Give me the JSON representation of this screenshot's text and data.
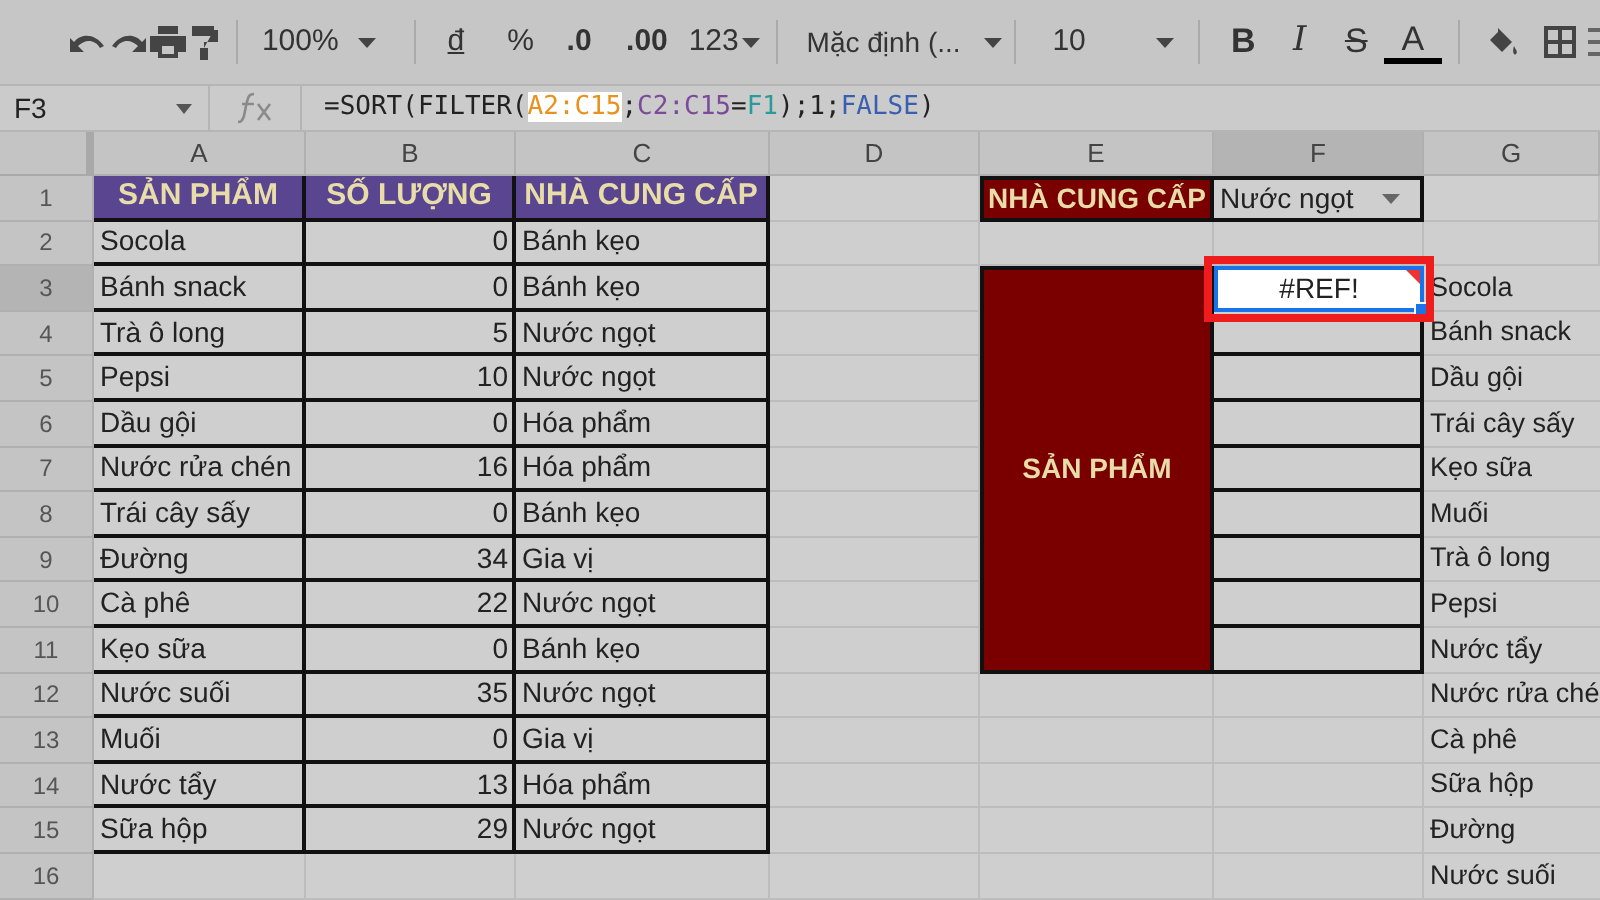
{
  "toolbar": {
    "zoom": "100%",
    "currency": "đ",
    "percent": "%",
    "decrease_decimals": ".0",
    "increase_decimals": ".00",
    "number_format": "123",
    "font": "Mặc định (...",
    "font_size": "10",
    "bold": "B",
    "italic": "I",
    "strikethrough": "S",
    "text_color": "A"
  },
  "formula_bar": {
    "cell_ref": "F3",
    "formula": [
      {
        "text": "=SORT(FILTER(",
        "kind": "plain"
      },
      {
        "text": "A2:C15",
        "kind": "range1"
      },
      {
        "text": ";",
        "kind": "plain"
      },
      {
        "text": "C2:C15",
        "kind": "range2"
      },
      {
        "text": "=",
        "kind": "plain"
      },
      {
        "text": "F1",
        "kind": "ref"
      },
      {
        "text": ");1;",
        "kind": "plain"
      },
      {
        "text": "FALSE",
        "kind": "bool"
      },
      {
        "text": ")",
        "kind": "plain"
      }
    ]
  },
  "columns": [
    {
      "label": "A",
      "selected": false
    },
    {
      "label": "B",
      "selected": false
    },
    {
      "label": "C",
      "selected": false
    },
    {
      "label": "D",
      "selected": false
    },
    {
      "label": "E",
      "selected": false
    },
    {
      "label": "F",
      "selected": true
    },
    {
      "label": "G",
      "selected": false
    }
  ],
  "row_numbers": [
    {
      "label": "1",
      "selected": false
    },
    {
      "label": "2",
      "selected": false
    },
    {
      "label": "3",
      "selected": true
    },
    {
      "label": "4",
      "selected": false
    },
    {
      "label": "5",
      "selected": false
    },
    {
      "label": "6",
      "selected": false
    },
    {
      "label": "7",
      "selected": false
    },
    {
      "label": "8",
      "selected": false
    },
    {
      "label": "9",
      "selected": false
    },
    {
      "label": "10",
      "selected": false
    },
    {
      "label": "11",
      "selected": false
    },
    {
      "label": "12",
      "selected": false
    },
    {
      "label": "13",
      "selected": false
    },
    {
      "label": "14",
      "selected": false
    },
    {
      "label": "15",
      "selected": false
    },
    {
      "label": "16",
      "selected": false
    }
  ],
  "table": {
    "headers": [
      "SẢN PHẨM",
      "SỐ LƯỢNG",
      "NHÀ CUNG CẤP"
    ],
    "rows": [
      [
        "Socola",
        "0",
        "Bánh kẹo"
      ],
      [
        "Bánh snack",
        "0",
        "Bánh kẹo"
      ],
      [
        "Trà ô long",
        "5",
        "Nước ngọt"
      ],
      [
        "Pepsi",
        "10",
        "Nước ngọt"
      ],
      [
        "Dầu gội",
        "0",
        "Hóa phẩm"
      ],
      [
        "Nước rửa chén",
        "16",
        "Hóa phẩm"
      ],
      [
        "Trái cây sấy",
        "0",
        "Bánh kẹo"
      ],
      [
        "Đường",
        "34",
        "Gia vị"
      ],
      [
        "Cà phê",
        "22",
        "Nước ngọt"
      ],
      [
        "Kẹo sữa",
        "0",
        "Bánh kẹo"
      ],
      [
        "Nước suối",
        "35",
        "Nước ngọt"
      ],
      [
        "Muối",
        "0",
        "Gia vị"
      ],
      [
        "Nước tẩy",
        "13",
        "Hóa phẩm"
      ],
      [
        "Sữa hộp",
        "29",
        "Nước ngọt"
      ]
    ]
  },
  "filter": {
    "label": "NHÀ CUNG CẤP",
    "value": "Nước ngọt",
    "result_label": "SẢN PHẨM",
    "result": "#REF!"
  },
  "column_g": [
    "Socola",
    "Bánh snack",
    "Dầu gội",
    "Trái cây sấy",
    "Kẹo sữa",
    "Muối",
    "Trà ô long",
    "Pepsi",
    "Nước tẩy",
    "Nước rửa ché",
    "Cà phê",
    "Sữa hộp",
    "Đường",
    "Nước suối"
  ]
}
